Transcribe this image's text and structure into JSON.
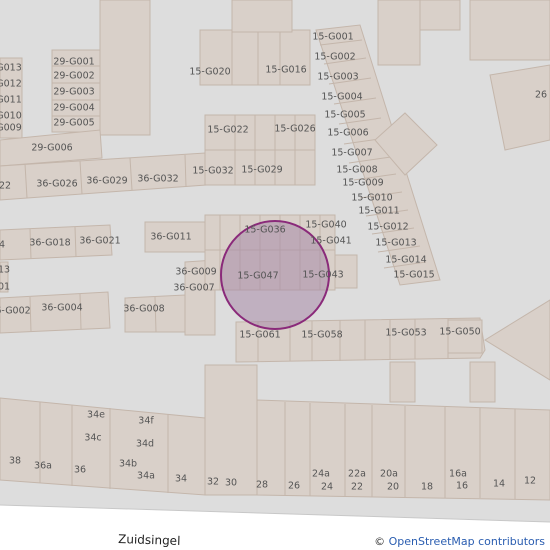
{
  "map": {
    "marker_fill": "#a88aa8",
    "marker_stroke": "#8a2a7a"
  },
  "labels": [
    {
      "id": "15-G001",
      "text": "15-G001"
    },
    {
      "id": "15-G002",
      "text": "15-G002"
    },
    {
      "id": "15-G003",
      "text": "15-G003"
    },
    {
      "id": "15-G004",
      "text": "15-G004"
    },
    {
      "id": "15-G005",
      "text": "15-G005"
    },
    {
      "id": "15-G006",
      "text": "15-G006"
    },
    {
      "id": "15-G007",
      "text": "15-G007"
    },
    {
      "id": "15-G008",
      "text": "15-G008"
    },
    {
      "id": "15-G009",
      "text": "15-G009"
    },
    {
      "id": "15-G010",
      "text": "15-G010"
    },
    {
      "id": "15-G011",
      "text": "15-G011"
    },
    {
      "id": "15-G012",
      "text": "15-G012"
    },
    {
      "id": "15-G013",
      "text": "15-G013"
    },
    {
      "id": "15-G014",
      "text": "15-G014"
    },
    {
      "id": "15-G015",
      "text": "15-G015"
    },
    {
      "id": "15-G016",
      "text": "15-G016"
    },
    {
      "id": "15-G020",
      "text": "15-G020"
    },
    {
      "id": "15-G022",
      "text": "15-G022"
    },
    {
      "id": "15-G026",
      "text": "15-G026"
    },
    {
      "id": "15-G029",
      "text": "15-G029"
    },
    {
      "id": "15-G032",
      "text": "15-G032"
    },
    {
      "id": "15-G036",
      "text": "15-G036"
    },
    {
      "id": "15-G040",
      "text": "15-G040"
    },
    {
      "id": "15-G041",
      "text": "15-G041"
    },
    {
      "id": "15-G043",
      "text": "15-G043"
    },
    {
      "id": "15-G047",
      "text": "15-G047"
    },
    {
      "id": "15-G050",
      "text": "15-G050"
    },
    {
      "id": "15-G053",
      "text": "15-G053"
    },
    {
      "id": "15-G058",
      "text": "15-G058"
    },
    {
      "id": "15-G061",
      "text": "15-G061"
    },
    {
      "id": "29-G001",
      "text": "29-G001"
    },
    {
      "id": "29-G002",
      "text": "29-G002"
    },
    {
      "id": "29-G003",
      "text": "29-G003"
    },
    {
      "id": "29-G004",
      "text": "29-G004"
    },
    {
      "id": "29-G005",
      "text": "29-G005"
    },
    {
      "id": "29-G006",
      "text": "29-G006"
    },
    {
      "id": "36-G002",
      "text": "36-G002"
    },
    {
      "id": "36-G004",
      "text": "36-G004"
    },
    {
      "id": "36-G007",
      "text": "36-G007"
    },
    {
      "id": "36-G008",
      "text": "36-G008"
    },
    {
      "id": "36-G009",
      "text": "36-G009"
    },
    {
      "id": "36-G011",
      "text": "36-G011"
    },
    {
      "id": "36-G018",
      "text": "36-G018"
    },
    {
      "id": "36-G021",
      "text": "36-G021"
    },
    {
      "id": "36-G026",
      "text": "36-G026"
    },
    {
      "id": "36-G029",
      "text": "36-G029"
    },
    {
      "id": "36-G032",
      "text": "36-G032"
    },
    {
      "id": "edge-G013",
      "text": "G013"
    },
    {
      "id": "edge-G012",
      "text": "G012"
    },
    {
      "id": "edge-G011",
      "text": "G011"
    },
    {
      "id": "edge-G010",
      "text": "G010"
    },
    {
      "id": "edge-G009",
      "text": "G009"
    },
    {
      "id": "edge-22",
      "text": "22"
    },
    {
      "id": "edge-4",
      "text": "4"
    },
    {
      "id": "edge-13",
      "text": "13"
    },
    {
      "id": "edge-01",
      "text": "01"
    },
    {
      "id": "edge-G002",
      "text": "G002"
    },
    {
      "id": "edge-26",
      "text": "26"
    },
    {
      "id": "h38",
      "text": "38"
    },
    {
      "id": "h36a",
      "text": "36a"
    },
    {
      "id": "h36",
      "text": "36"
    },
    {
      "id": "h34e",
      "text": "34e"
    },
    {
      "id": "h34c",
      "text": "34c"
    },
    {
      "id": "h34f",
      "text": "34f"
    },
    {
      "id": "h34d",
      "text": "34d"
    },
    {
      "id": "h34b",
      "text": "34b"
    },
    {
      "id": "h34a",
      "text": "34a"
    },
    {
      "id": "h34",
      "text": "34"
    },
    {
      "id": "h32",
      "text": "32"
    },
    {
      "id": "h30",
      "text": "30"
    },
    {
      "id": "h28",
      "text": "28"
    },
    {
      "id": "h26",
      "text": "26"
    },
    {
      "id": "h24a",
      "text": "24a"
    },
    {
      "id": "h24",
      "text": "24"
    },
    {
      "id": "h22a",
      "text": "22a"
    },
    {
      "id": "h22",
      "text": "22"
    },
    {
      "id": "h20a",
      "text": "20a"
    },
    {
      "id": "h20",
      "text": "20"
    },
    {
      "id": "h18",
      "text": "18"
    },
    {
      "id": "h16a",
      "text": "16a"
    },
    {
      "id": "h16",
      "text": "16"
    },
    {
      "id": "h14",
      "text": "14"
    },
    {
      "id": "h12",
      "text": "12"
    }
  ],
  "street": {
    "name": "Zuidsingel"
  },
  "attribution": {
    "copyright": "©",
    "link_text": "OpenStreetMap contributors"
  }
}
